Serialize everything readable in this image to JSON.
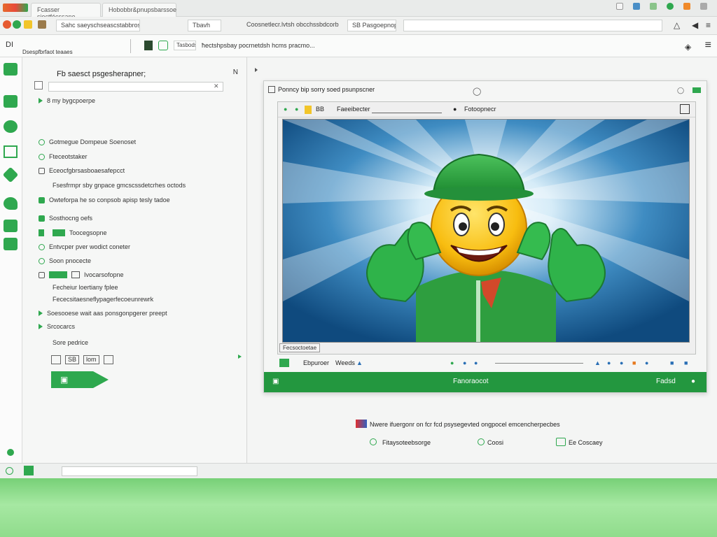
{
  "tabs": [
    {
      "label": "Fcasser sioctfécssane"
    },
    {
      "label": "Hobobbr&pnupsbarssoe"
    }
  ],
  "toolbar": {
    "address": "Sahc saeyschseascstabbros",
    "address_sub": "Tbavh",
    "breadcrumb": "Coosnetlecr.lvtsh obcchssbdcorb",
    "breadcrumb_tail": "SB Pasgoepnopn"
  },
  "subbar": {
    "panel_label": "Dsespfbrfaot teaaes",
    "small_label": "Tasbods",
    "main_label": "ħectshpsbay pocrnetdsh hcms pracmo..."
  },
  "left_panel": {
    "title": "Fb saesct psgesherapner;",
    "page_num": "N",
    "search_value": "",
    "items": [
      {
        "label": "8 my bygcpoerpe"
      },
      {
        "label": "Gotmegue Dompeue Soenoset"
      },
      {
        "label": "Fteceotstaker"
      },
      {
        "label": "Eceocfgbrsasboaesafepcct"
      },
      {
        "label": "Fsesfrmpr sby gnpace gmcscssdetcrhes octods"
      },
      {
        "label": "Owteforpa he so conpsob apisp tesly tadoe"
      },
      {
        "label": "Sosthocng oefs"
      },
      {
        "label": "Toocegsopne"
      },
      {
        "label": "Entvcper pver wodict coneter"
      },
      {
        "label": "Soon pnocecte"
      },
      {
        "label": "Ivocarsofopne"
      },
      {
        "label": "Fecheiur loertiany fplee"
      },
      {
        "label": "Fececsitaesneflypagerfecoeunrewrk"
      },
      {
        "label": "Soesooese wait aas ponsgonpgerer preept"
      },
      {
        "label": "Srcocarcs"
      },
      {
        "label": "Sore pedrice"
      }
    ],
    "btn_a": "SB",
    "btn_b": "lom"
  },
  "card": {
    "title": "Ponncy bip sorry soed psunpscner",
    "inner_title": "BB",
    "inner_title_b": "Faeeibecter",
    "inner_title_c": "Fotoopnecr",
    "inner_foot": "Fecsoctoetae",
    "bottom_left": "Ebpuroer",
    "bottom_mid": "Weeds",
    "strip_center": "Fanoraocot",
    "strip_right": "Fadsd"
  },
  "below": {
    "headline": "Nwere ifuergonr on fcr fcd psysegevted ongpocel emcencherpecbes",
    "opt1": "Fitaysoteebsorge",
    "opt2": "Coosi",
    "opt3": "Ee Coscaey"
  },
  "colors": {
    "accent": "#2fa84f",
    "strip": "#23973f",
    "ray_bg": "#1a5a8c",
    "face": "#ffc000"
  },
  "icons": [
    "shield-icon",
    "refresh-icon",
    "camera-icon",
    "settings-icon"
  ]
}
